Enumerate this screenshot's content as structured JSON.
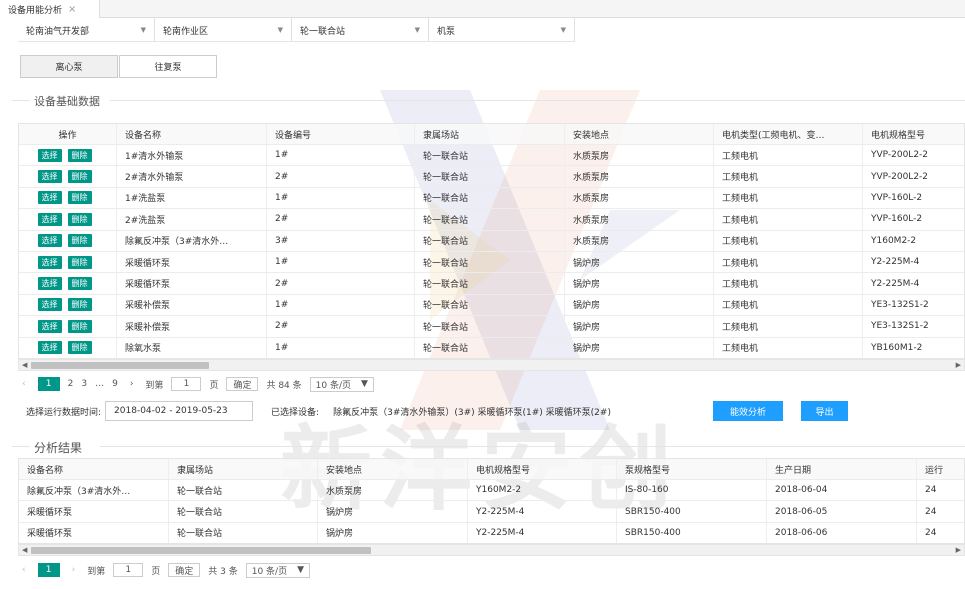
{
  "tabbar": {
    "tab_label": "设备用能分析",
    "close_glyph": "×"
  },
  "filters": [
    {
      "value": "轮南油气开发部"
    },
    {
      "value": "轮南作业区"
    },
    {
      "value": "轮一联合站"
    },
    {
      "value": "机泵"
    }
  ],
  "pump_tabs": [
    {
      "label": "离心泵",
      "active": true
    },
    {
      "label": "往复泵",
      "active": false
    }
  ],
  "basic_section": {
    "title": "设备基础数据"
  },
  "basic_table": {
    "select_label": "选择",
    "delete_label": "删除",
    "headers": [
      "操作",
      "设备名称",
      "设备编号",
      "隶属场站",
      "安装地点",
      "电机类型(工频电机、变…",
      "电机规格型号"
    ],
    "rows": [
      [
        "1#清水外输泵",
        "1#",
        "轮一联合站",
        "水质泵房",
        "工频电机",
        "YVP-200L2-2"
      ],
      [
        "2#清水外输泵",
        "2#",
        "轮一联合站",
        "水质泵房",
        "工频电机",
        "YVP-200L2-2"
      ],
      [
        "1#洗盐泵",
        "1#",
        "轮一联合站",
        "水质泵房",
        "工频电机",
        "YVP-160L-2"
      ],
      [
        "2#洗盐泵",
        "2#",
        "轮一联合站",
        "水质泵房",
        "工频电机",
        "YVP-160L-2"
      ],
      [
        "除氟反冲泵（3#清水外…",
        "3#",
        "轮一联合站",
        "水质泵房",
        "工频电机",
        "Y160M2-2"
      ],
      [
        "采暖循环泵",
        "1#",
        "轮一联合站",
        "锅炉房",
        "工频电机",
        "Y2-225M-4"
      ],
      [
        "采暖循环泵",
        "2#",
        "轮一联合站",
        "锅炉房",
        "工频电机",
        "Y2-225M-4"
      ],
      [
        "采暖补偿泵",
        "1#",
        "轮一联合站",
        "锅炉房",
        "工频电机",
        "YE3-132S1-2"
      ],
      [
        "采暖补偿泵",
        "2#",
        "轮一联合站",
        "锅炉房",
        "工频电机",
        "YE3-132S1-2"
      ],
      [
        "除氧水泵",
        "1#",
        "轮一联合站",
        "锅炉房",
        "工频电机",
        "YB160M1-2"
      ]
    ]
  },
  "basic_pager": {
    "prev": "‹",
    "next": "›",
    "current": "1",
    "pages": [
      "2",
      "3",
      "…",
      "9"
    ],
    "goto_label": "到第",
    "goto_value": "1",
    "page_unit": "页",
    "confirm": "确定",
    "total": "共 84 条",
    "per_page": "10 条/页"
  },
  "toolbar": {
    "date_label": "选择运行数据时间:",
    "date_value": "2018-04-02 - 2019-05-23",
    "selected_label": "已选择设备:",
    "selected_value": "除氟反冲泵（3#清水外输泵）(3#)  采暖循环泵(1#)  采暖循环泵(2#)",
    "analyze_btn": "能效分析",
    "export_btn": "导出"
  },
  "result_section": {
    "title": "分析结果"
  },
  "result_table": {
    "headers": [
      "设备名称",
      "隶属场站",
      "安装地点",
      "电机规格型号",
      "泵规格型号",
      "生产日期",
      "运行"
    ],
    "rows": [
      [
        "除氟反冲泵（3#清水外…",
        "轮一联合站",
        "水质泵房",
        "Y160M2-2",
        "IS-80-160",
        "2018-06-04",
        "24"
      ],
      [
        "采暖循环泵",
        "轮一联合站",
        "锅炉房",
        "Y2-225M-4",
        "SBR150-400",
        "2018-06-05",
        "24"
      ],
      [
        "采暖循环泵",
        "轮一联合站",
        "锅炉房",
        "Y2-225M-4",
        "SBR150-400",
        "2018-06-06",
        "24"
      ]
    ]
  },
  "result_pager": {
    "prev": "‹",
    "next": "›",
    "current": "1",
    "goto_label": "到第",
    "goto_value": "1",
    "page_unit": "页",
    "confirm": "确定",
    "total": "共 3 条",
    "per_page": "10 条/页"
  },
  "watermark": {
    "text": "新洋安创"
  },
  "colors": {
    "accent": "#009688",
    "primary": "#1e9fff"
  }
}
